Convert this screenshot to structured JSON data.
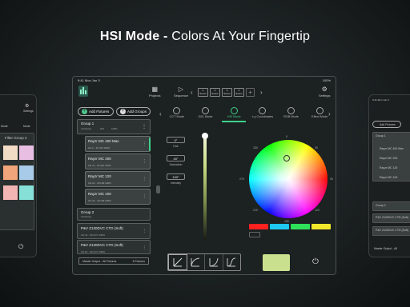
{
  "headline": {
    "bold": "HSI Mode -",
    "rest": " Colors At Your Fingertip"
  },
  "status": {
    "time": "9:41  Mon Jun 3",
    "battery": "100%"
  },
  "topbar": {
    "projects": "Projects",
    "sequence": "Sequence",
    "settings": "Settings",
    "scenes": [
      {
        "num": "1",
        "label": "Scene"
      },
      {
        "num": "2",
        "label": "Scene"
      },
      {
        "num": "3",
        "label": "Scene"
      },
      {
        "num": "4",
        "label": "Scene"
      }
    ]
  },
  "left_panel": {
    "add_fixtures": "Add Fixtures",
    "add_groups": "Add Groups",
    "group1": {
      "name": "Group 1",
      "sub": "4 Fixtures",
      "v1": "HSI",
      "v2": "100%"
    },
    "fixtures": [
      {
        "name": "Rayzr MC 400 Max",
        "sub": "CH 1 - 10    HSI    100%"
      },
      {
        "name": "Rayzr MC 200",
        "sub": "CH 11 - 20   HSI    100%"
      },
      {
        "name": "Rayzr MC 120",
        "sub": "CH 21 - 30   HSI    100%"
      },
      {
        "name": "Rayzr MC 100",
        "sub": "CH 31 - 40   HSI    100%"
      }
    ],
    "group2": {
      "name": "Group 2",
      "sub": "0 Fixtures"
    },
    "extra": [
      {
        "name": "P&V Z120DVC CTD (Soft)",
        "sub": "CH 41 - 50   CCT    100%"
      },
      {
        "name": "P&V Z120DVC CTD (Soft)",
        "sub": "CH 51 - 60   CCT    100%"
      }
    ],
    "master_output": "Master Output - All Fixtures",
    "master_count": "6 Fixtures"
  },
  "modes": {
    "tabs": [
      "CCT Mode",
      "GEL Mode",
      "HSI Mode",
      "x,y Coordinates",
      "RGB Mode",
      "Effect Mode"
    ],
    "active_index": 2
  },
  "hsi": {
    "hue_value": "0°",
    "hue_label": "Hue",
    "saturation_value": "40°",
    "saturation_label": "Saturation",
    "intensity_value": "100°",
    "intensity_label": "Intensity",
    "intensity_level": 1.0
  },
  "wheel_labels": {
    "top": "0",
    "tr": "30",
    "right": "90",
    "br": "120",
    "bottom": "180",
    "bl": "210",
    "left": "270",
    "tl": "330"
  },
  "swatches": [
    "#ff2020",
    "#1ec8f0",
    "#2ee05a",
    "#f0e82a"
  ],
  "preview_color": "#c9e08f",
  "side_left": {
    "settings": "Settings",
    "mode": "Mode",
    "filter_title": "Filter Group 2"
  },
  "side_right": {
    "add_fixtures": "Add Fixtures",
    "group1": "Group 1",
    "fixture1": "Rayzr MC 400 Max",
    "fixture2": "Rayzr MC 200",
    "fixture3": "Rayzr MC 120",
    "fixture4": "Rayzr MC 100",
    "group2": "Group 2",
    "extra1": "P&V Z120DVC CTD (Soft)",
    "extra2": "P&V Z120DVC CTD (Soft)",
    "master": "Master Output - All"
  }
}
